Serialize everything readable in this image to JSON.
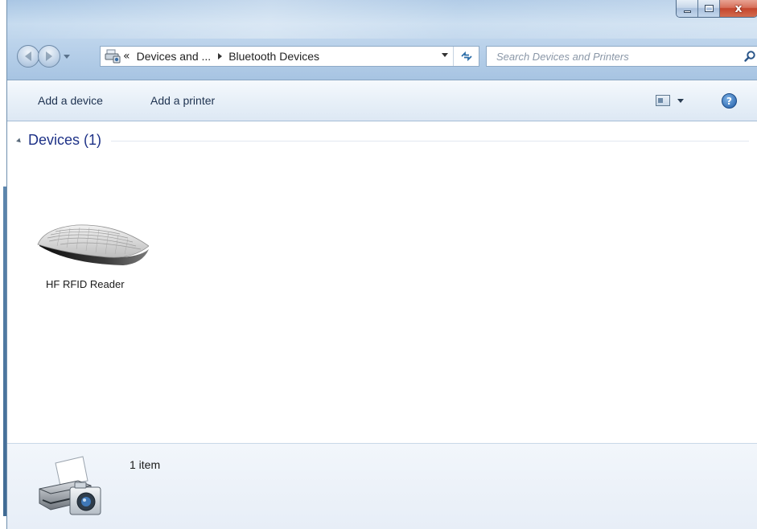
{
  "window": {
    "caption": {
      "minimize_icon": "minimize-icon",
      "maximize_icon": "maximize-icon",
      "close_glyph": "x"
    }
  },
  "navigation": {
    "back_icon": "back-arrow-icon",
    "forward_icon": "forward-arrow-icon",
    "recent_icon": "chevron-down-icon"
  },
  "address": {
    "overflow_chevrons": "«",
    "segment_parent": "Devices and ...",
    "segment_current": "Bluetooth Devices",
    "refresh_icon": "refresh-icon"
  },
  "search": {
    "placeholder": "Search Devices and Printers",
    "icon": "magnifier-icon"
  },
  "commandbar": {
    "add_device": "Add a device",
    "add_printer": "Add a printer",
    "view_icon": "view-options-icon",
    "help_glyph": "?"
  },
  "content": {
    "group_label": "Devices (1)",
    "devices": [
      {
        "name": "HF RFID Reader",
        "icon": "keyboard-icon"
      }
    ]
  },
  "details": {
    "item_count": "1 item",
    "icon": "devices-and-printers-icon"
  },
  "colors": {
    "group_label": "#1e3287",
    "close_button": "#c4452d",
    "glass": "#b9d1ea"
  }
}
